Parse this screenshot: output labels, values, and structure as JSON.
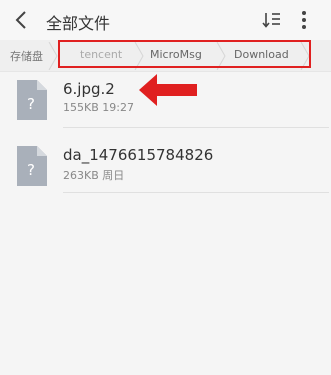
{
  "header": {
    "title": "全部文件"
  },
  "breadcrumb": {
    "storage": "存储盘",
    "items": [
      "tencent",
      "MicroMsg",
      "Download"
    ]
  },
  "files": [
    {
      "name": "6.jpg.2",
      "size": "155KB",
      "time": "19:27",
      "icon": "unknown-file-icon"
    },
    {
      "name": "da_1476615784826",
      "size": "263KB",
      "time": "周日",
      "icon": "unknown-file-icon"
    }
  ],
  "colors": {
    "accent": "#e02020",
    "icon": "#a9b0ba"
  }
}
